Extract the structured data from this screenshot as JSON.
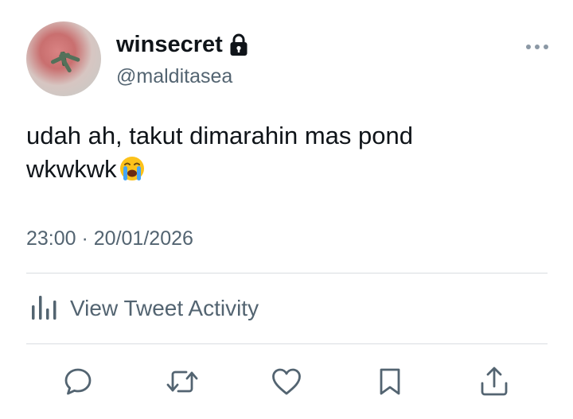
{
  "tweet": {
    "display_name": "winsecret",
    "handle": "@malditasea",
    "text_line1": "udah ah, takut dimarahin mas pond",
    "text_line2": "wkwkwk",
    "emoji": "loudly-crying-face",
    "timestamp": "23:00 · 20/01/2026",
    "activity_label": "View Tweet Activity"
  },
  "icons": {
    "lock": "lock-icon",
    "more": "more-horizontal-icon",
    "activity": "bar-chart-icon",
    "reply": "reply-icon",
    "retweet": "retweet-icon",
    "like": "heart-icon",
    "bookmark": "bookmark-icon",
    "share": "share-icon"
  },
  "colors": {
    "text_primary": "#0f1419",
    "text_secondary": "#536471",
    "divider": "#d9dde1"
  }
}
